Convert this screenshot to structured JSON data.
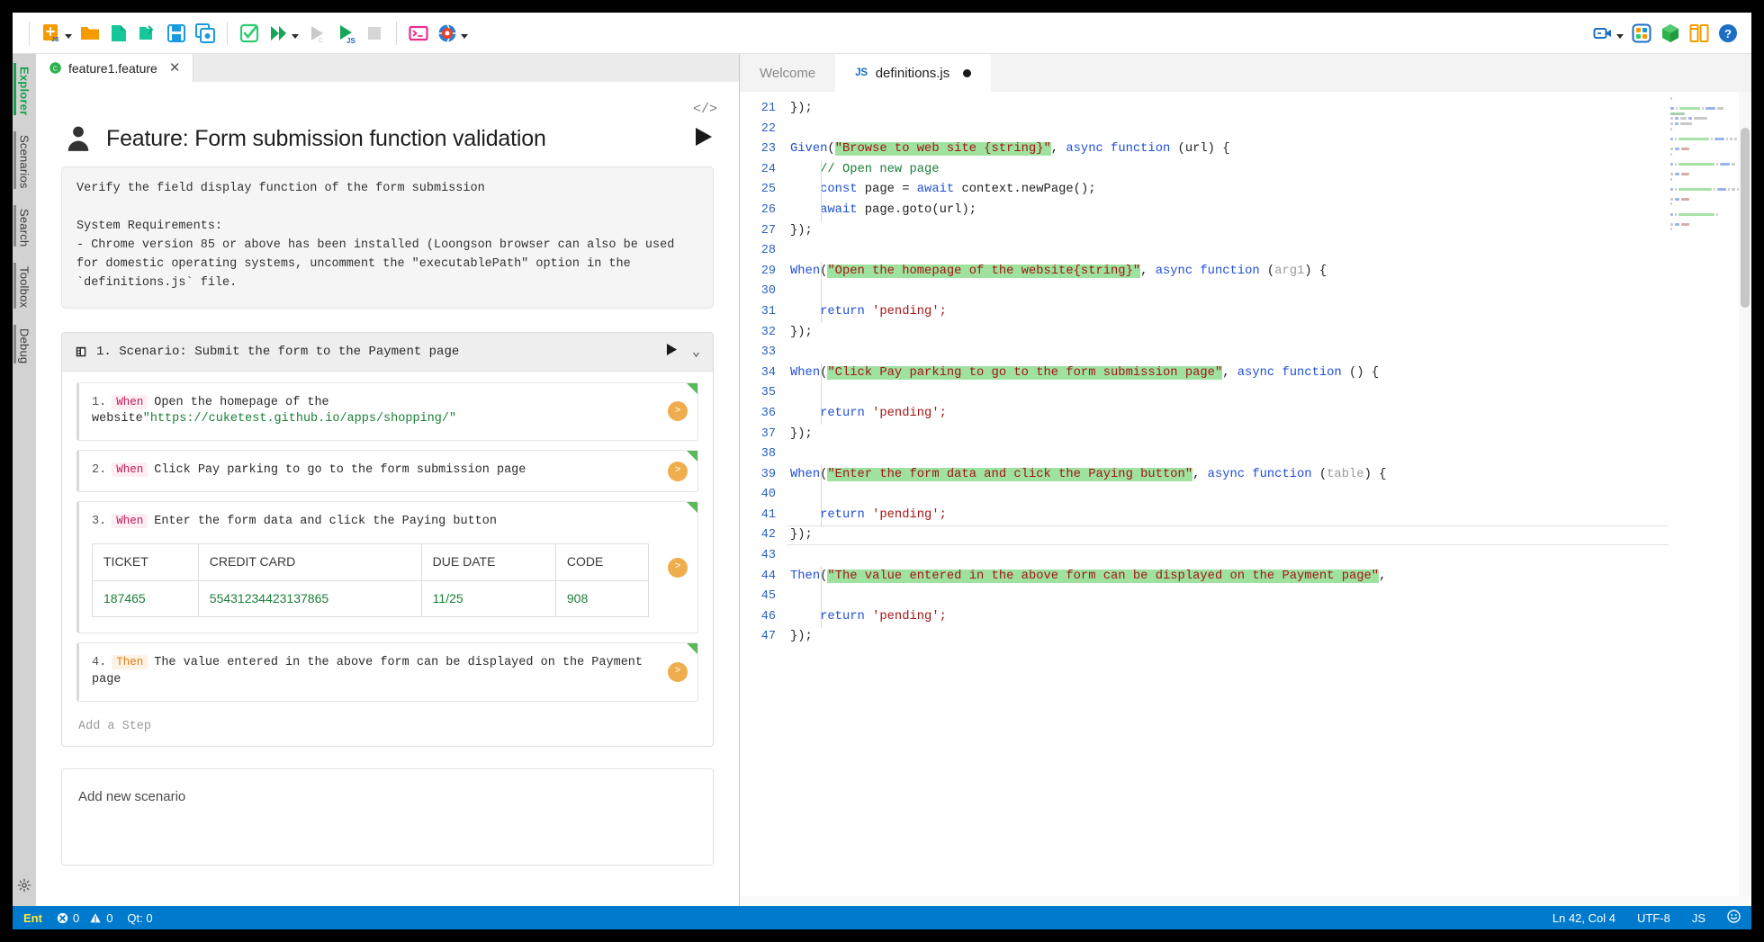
{
  "toolbar": {
    "left_buttons": [
      {
        "name": "new-js-project",
        "icon": "new-file-js-icon",
        "has_caret": true
      },
      {
        "name": "open-folder",
        "icon": "open-folder-icon",
        "has_caret": false
      },
      {
        "name": "new-file",
        "icon": "new-document-icon",
        "has_caret": false
      },
      {
        "name": "open-file",
        "icon": "open-file-icon",
        "has_caret": false
      },
      {
        "name": "save",
        "icon": "save-icon",
        "has_caret": false
      },
      {
        "name": "save-all",
        "icon": "save-all-icon",
        "has_caret": false
      }
    ],
    "run_buttons": [
      {
        "name": "check-syntax",
        "icon": "check-square-icon",
        "has_caret": false
      },
      {
        "name": "run-all",
        "icon": "fast-forward-icon",
        "has_caret": true
      },
      {
        "name": "run-csharp",
        "icon": "play-disabled-icon",
        "has_caret": false
      },
      {
        "name": "run-js",
        "icon": "play-js-icon",
        "has_caret": false
      },
      {
        "name": "stop",
        "icon": "stop-icon",
        "has_caret": false
      }
    ],
    "tool_buttons": [
      {
        "name": "terminal",
        "icon": "terminal-icon",
        "has_caret": false
      },
      {
        "name": "browser",
        "icon": "globe-icon",
        "has_caret": true
      }
    ],
    "right_buttons": [
      {
        "name": "record",
        "icon": "video-camera-icon",
        "has_caret": true
      },
      {
        "name": "app-grid",
        "icon": "app-grid-icon",
        "has_caret": false
      },
      {
        "name": "package",
        "icon": "cube-package-icon",
        "has_caret": false
      },
      {
        "name": "layout",
        "icon": "split-layout-icon",
        "has_caret": false
      },
      {
        "name": "help",
        "icon": "help-circle-icon",
        "has_caret": false
      }
    ]
  },
  "rail": {
    "items": [
      {
        "label": "Explorer",
        "active": true
      },
      {
        "label": "Scenarios",
        "active": false
      },
      {
        "label": "Search",
        "active": false
      },
      {
        "label": "Toolbox",
        "active": false
      },
      {
        "label": "Debug",
        "active": false
      }
    ],
    "settings_icon": "gear-icon"
  },
  "feature_tab": {
    "label": "feature1.feature",
    "icon": "cuke-icon",
    "close": "✕"
  },
  "feature": {
    "code_toggle": "</>",
    "title": "Feature: Form submission function validation",
    "description": "Verify the field display function of the form submission\n\nSystem Requirements:\n- Chrome version 85 or above has been installed (Loongson browser can also be used for domestic operating systems, uncomment the \"executablePath\" option in the `definitions.js` file.",
    "run_feature_label": "▶",
    "scenario": {
      "header": "1. Scenario: Submit the form to the Payment page",
      "run_label": "▶",
      "chevron": "⌄",
      "steps": [
        {
          "num": "1.",
          "keyword": "When",
          "keyword_type": "when",
          "text": "Open the homepage of the website",
          "quoted": "\"https://cuketest.github.io/apps/shopping/\"",
          "pill": ">"
        },
        {
          "num": "2.",
          "keyword": "When",
          "keyword_type": "when",
          "text": "Click Pay parking to go to the form submission page",
          "quoted": "",
          "pill": ">"
        },
        {
          "num": "3.",
          "keyword": "When",
          "keyword_type": "when",
          "text": "Enter the form data and click the Paying button",
          "quoted": "",
          "pill": ">"
        },
        {
          "num": "4.",
          "keyword": "Then",
          "keyword_type": "then",
          "text": "The value entered in the above form can be displayed on the Payment page",
          "quoted": "",
          "pill": ">"
        }
      ],
      "data_table": {
        "headers": [
          "TICKET",
          "CREDIT CARD",
          "DUE DATE",
          "CODE"
        ],
        "rows": [
          [
            "187465",
            "55431234423137865",
            "11/25",
            "908"
          ]
        ]
      },
      "add_step_label": "Add a Step"
    },
    "add_scenario_label": "Add new scenario"
  },
  "editor": {
    "tabs": [
      {
        "label": "Welcome",
        "active": false,
        "icon": "",
        "dirty": false
      },
      {
        "label": "definitions.js",
        "active": true,
        "icon": "JS",
        "dirty": true
      }
    ],
    "first_line_number": 21,
    "lines": [
      {
        "n": 21,
        "tokens": [
          {
            "t": "});",
            "c": "c-fn"
          }
        ]
      },
      {
        "n": 22,
        "tokens": []
      },
      {
        "n": 23,
        "tokens": [
          {
            "t": "Given",
            "c": "c-blue"
          },
          {
            "t": "(",
            "c": "c-fn"
          },
          {
            "t": "\"Browse to web site {string}\"",
            "c": "c-hl"
          },
          {
            "t": ", ",
            "c": "c-fn"
          },
          {
            "t": "async function",
            "c": "c-blue"
          },
          {
            "t": " (url) {",
            "c": "c-fn"
          }
        ]
      },
      {
        "n": 24,
        "tokens": [
          {
            "t": "    // Open new page",
            "c": "c-com"
          }
        ]
      },
      {
        "n": 25,
        "tokens": [
          {
            "t": "    ",
            "c": "c-fn"
          },
          {
            "t": "const",
            "c": "c-blue"
          },
          {
            "t": " page = ",
            "c": "c-fn"
          },
          {
            "t": "await",
            "c": "c-blue"
          },
          {
            "t": " context.newPage();",
            "c": "c-fn"
          }
        ]
      },
      {
        "n": 26,
        "tokens": [
          {
            "t": "    ",
            "c": "c-fn"
          },
          {
            "t": "await",
            "c": "c-blue"
          },
          {
            "t": " page.goto(url);",
            "c": "c-fn"
          }
        ]
      },
      {
        "n": 27,
        "tokens": [
          {
            "t": "});",
            "c": "c-fn"
          }
        ]
      },
      {
        "n": 28,
        "tokens": []
      },
      {
        "n": 29,
        "tokens": [
          {
            "t": "When",
            "c": "c-blue"
          },
          {
            "t": "(",
            "c": "c-fn"
          },
          {
            "t": "\"Open the homepage of the website{string}\"",
            "c": "c-hl"
          },
          {
            "t": ", ",
            "c": "c-fn"
          },
          {
            "t": "async function",
            "c": "c-blue"
          },
          {
            "t": " (",
            "c": "c-fn"
          },
          {
            "t": "arg1",
            "c": "c-par"
          },
          {
            "t": ") {",
            "c": "c-fn"
          }
        ]
      },
      {
        "n": 30,
        "tokens": []
      },
      {
        "n": 31,
        "tokens": [
          {
            "t": "    ",
            "c": "c-fn"
          },
          {
            "t": "return",
            "c": "c-blue"
          },
          {
            "t": " 'pending';",
            "c": "c-str"
          }
        ]
      },
      {
        "n": 32,
        "tokens": [
          {
            "t": "});",
            "c": "c-fn"
          }
        ]
      },
      {
        "n": 33,
        "tokens": []
      },
      {
        "n": 34,
        "tokens": [
          {
            "t": "When",
            "c": "c-blue"
          },
          {
            "t": "(",
            "c": "c-fn"
          },
          {
            "t": "\"Click Pay parking to go to the form submission page\"",
            "c": "c-hl"
          },
          {
            "t": ", ",
            "c": "c-fn"
          },
          {
            "t": "async function",
            "c": "c-blue"
          },
          {
            "t": " () {",
            "c": "c-fn"
          }
        ]
      },
      {
        "n": 35,
        "tokens": []
      },
      {
        "n": 36,
        "tokens": [
          {
            "t": "    ",
            "c": "c-fn"
          },
          {
            "t": "return",
            "c": "c-blue"
          },
          {
            "t": " 'pending';",
            "c": "c-str"
          }
        ]
      },
      {
        "n": 37,
        "tokens": [
          {
            "t": "});",
            "c": "c-fn"
          }
        ]
      },
      {
        "n": 38,
        "tokens": []
      },
      {
        "n": 39,
        "tokens": [
          {
            "t": "When",
            "c": "c-blue"
          },
          {
            "t": "(",
            "c": "c-fn"
          },
          {
            "t": "\"Enter the form data and click the Paying button\"",
            "c": "c-hl"
          },
          {
            "t": ", ",
            "c": "c-fn"
          },
          {
            "t": "async function",
            "c": "c-blue"
          },
          {
            "t": " (",
            "c": "c-fn"
          },
          {
            "t": "table",
            "c": "c-par"
          },
          {
            "t": ") {",
            "c": "c-fn"
          }
        ]
      },
      {
        "n": 40,
        "tokens": []
      },
      {
        "n": 41,
        "tokens": [
          {
            "t": "    ",
            "c": "c-fn"
          },
          {
            "t": "return",
            "c": "c-blue"
          },
          {
            "t": " 'pending';",
            "c": "c-str"
          }
        ]
      },
      {
        "n": 42,
        "tokens": [
          {
            "t": "});",
            "c": "c-fn"
          }
        ]
      },
      {
        "n": 43,
        "tokens": []
      },
      {
        "n": 44,
        "tokens": [
          {
            "t": "Then",
            "c": "c-blue"
          },
          {
            "t": "(",
            "c": "c-fn"
          },
          {
            "t": "\"The value entered in the above form can be displayed on the Payment page\"",
            "c": "c-hl"
          },
          {
            "t": ",",
            "c": "c-fn"
          }
        ]
      },
      {
        "n": 45,
        "tokens": []
      },
      {
        "n": 46,
        "tokens": [
          {
            "t": "    ",
            "c": "c-fn"
          },
          {
            "t": "return",
            "c": "c-blue"
          },
          {
            "t": " 'pending';",
            "c": "c-str"
          }
        ]
      },
      {
        "n": 47,
        "tokens": [
          {
            "t": "});",
            "c": "c-fn"
          }
        ]
      }
    ]
  },
  "statusbar": {
    "ent": "Ent",
    "errors_icon": "error-circle-icon",
    "errors": "0",
    "warnings_icon": "warning-triangle-icon",
    "warnings": "0",
    "qt": "Qt: 0",
    "position": "Ln 42, Col 4",
    "encoding": "UTF-8",
    "language": "JS",
    "feedback_icon": "smiley-icon"
  },
  "colors": {
    "accent": "#007acc",
    "green": "#17a24a",
    "orange": "#f59b00",
    "highlight": "#9fe2a0"
  }
}
